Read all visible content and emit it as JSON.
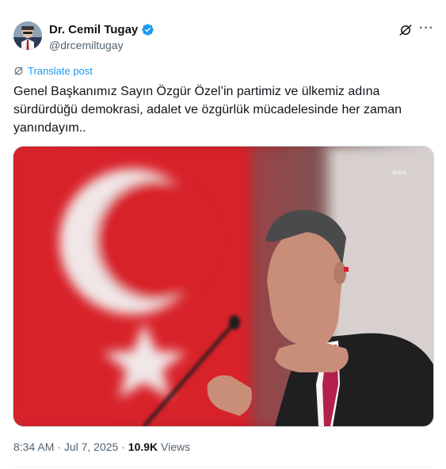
{
  "author": {
    "name": "Dr. Cemil Tugay",
    "handle": "@drcemiltugay",
    "verified": true
  },
  "header_icons": [
    "grok-icon",
    "more-icon"
  ],
  "more_glyph": "···",
  "translate_label": "Translate post",
  "post_text": "Genel Başkanımız Sayın Özgür Özel’in partimiz ve ülkemiz adına sürdürdüğü demokrasi, adalet ve özgürlük mücadelesinde her zaman yanındayım..",
  "media": {
    "watermark": "anka"
  },
  "meta": {
    "time": "8:34 AM",
    "separator": "·",
    "date": "Jul 7, 2025",
    "views_count": "10.9K",
    "views_label": "Views"
  },
  "colors": {
    "accent": "#1d9bf0",
    "secondary_text": "#536471",
    "flag_red": "#d8202a"
  }
}
